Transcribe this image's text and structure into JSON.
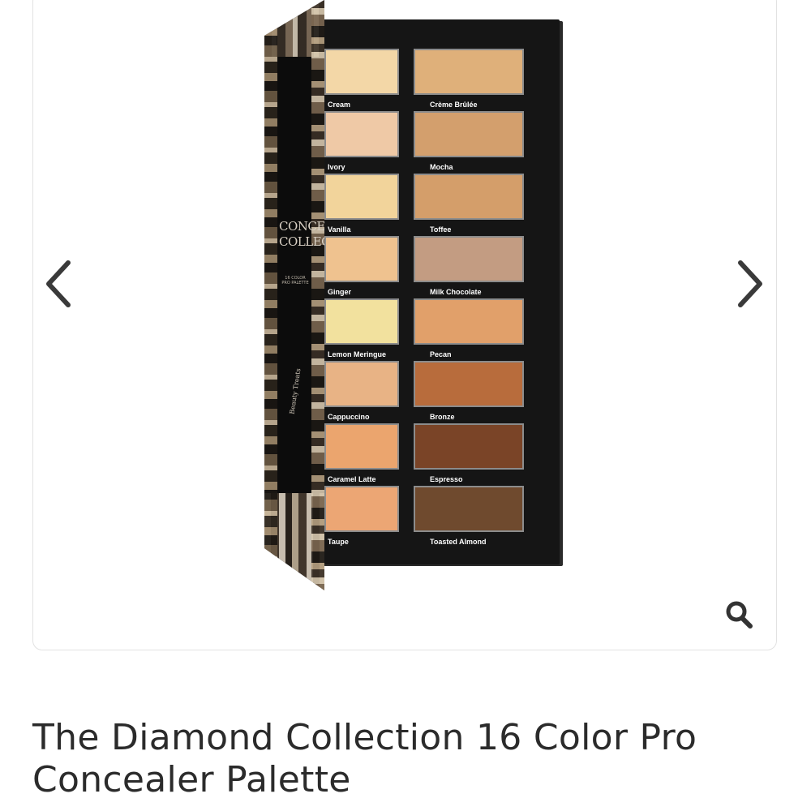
{
  "gallery": {
    "prev_icon": "chevron-left-icon",
    "next_icon": "chevron-right-icon",
    "zoom_icon": "magnifier-icon"
  },
  "palette_image": {
    "cover_title": "CONCEALER COLLECTION",
    "cover_subtitle": "16 COLOR PRO PALETTE",
    "cover_brand": "Beauty Treats",
    "left_column": [
      {
        "label": "Cream",
        "color": "#f3d7a7"
      },
      {
        "label": "Ivory",
        "color": "#efc9a6"
      },
      {
        "label": "Vanilla",
        "color": "#f2d49b"
      },
      {
        "label": "Ginger",
        "color": "#efc28f"
      },
      {
        "label": "Lemon Meringue",
        "color": "#f2e19e"
      },
      {
        "label": "Cappuccino",
        "color": "#e8b385"
      },
      {
        "label": "Caramel Latte",
        "color": "#eba56e"
      },
      {
        "label": "Taupe",
        "color": "#eca674"
      }
    ],
    "right_column": [
      {
        "label": "Crème Brûlée",
        "color": "#dfb07a"
      },
      {
        "label": "Mocha",
        "color": "#d39f6d"
      },
      {
        "label": "Toffee",
        "color": "#d49e6a"
      },
      {
        "label": "Milk Chocolate",
        "color": "#c39c82"
      },
      {
        "label": "Pecan",
        "color": "#e1a06a"
      },
      {
        "label": "Bronze",
        "color": "#b86c3c"
      },
      {
        "label": "Espresso",
        "color": "#7a4427"
      },
      {
        "label": "Toasted Almond",
        "color": "#6f4a2e"
      }
    ]
  },
  "product": {
    "title": "The Diamond Collection 16 Color Pro Concealer Palette"
  }
}
